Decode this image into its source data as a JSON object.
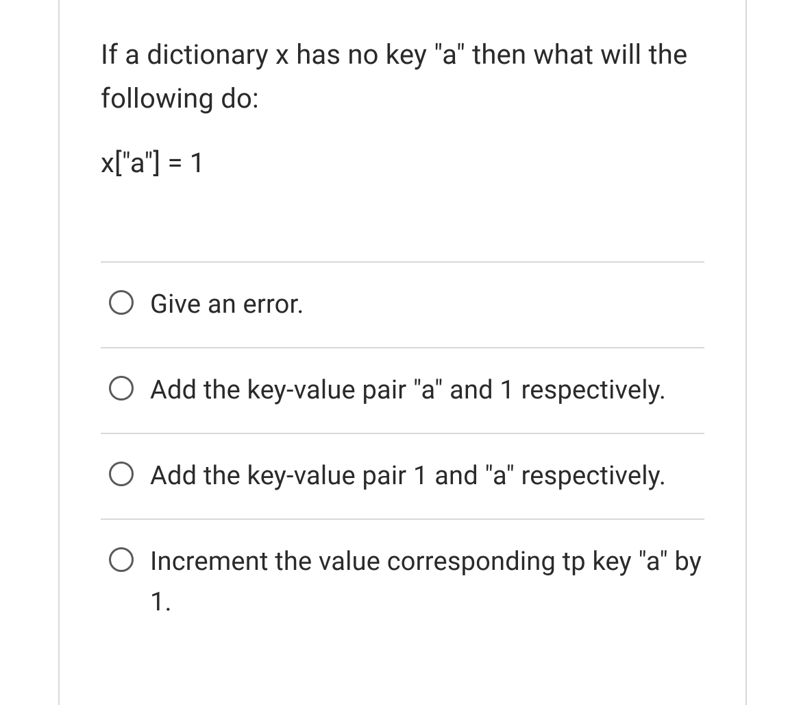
{
  "question": {
    "prompt_line1": "If a dictionary x has no key \"a\" then what will the following do:",
    "code": "x[\"a\"] = 1"
  },
  "options": [
    {
      "label": "Give an error."
    },
    {
      "label": "Add the key-value pair \"a\" and 1 respectively."
    },
    {
      "label": "Add the key-value pair 1 and \"a\" respectively."
    },
    {
      "label": "Increment the value corresponding tp key \"a\" by 1."
    }
  ]
}
